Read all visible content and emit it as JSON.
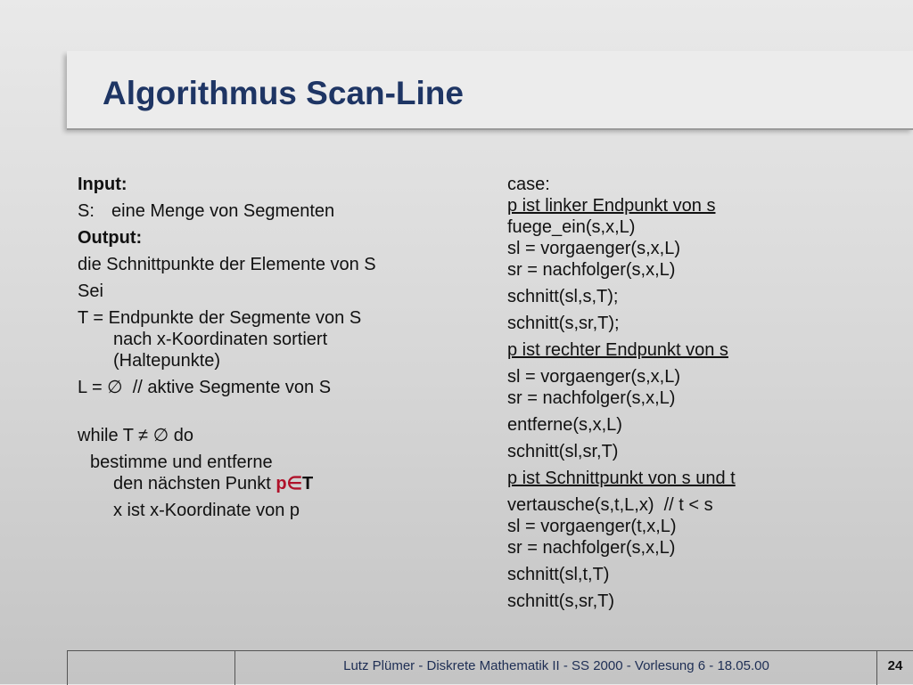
{
  "title": "Algorithmus Scan-Line",
  "left": {
    "input_label": "Input:",
    "s_label": "S:",
    "s_text": "eine Menge von Segmenten",
    "output_label": "Output:",
    "output_text": "die Schnittpunkte der Elemente von S",
    "sei": "Sei",
    "t_line1": "T = Endpunkte der Segmente von S",
    "t_line2": "nach x-Koordinaten sortiert",
    "t_line3": "(Haltepunkte)",
    "l_line": "L = ∅  // aktive Segmente von S",
    "while_line": "while T ≠ ∅ do",
    "bestimme_line1": "bestimme und entferne",
    "bestimme_line2_prefix": "den nächsten Punkt ",
    "bestimme_line2_p": "p∈",
    "bestimme_line2_t": "T",
    "x_line": "x ist x-Koordinate von p"
  },
  "right": {
    "case": "case:",
    "c1_head": "p ist linker Endpunkt von s",
    "c1_l1": "fuege_ein(s,x,L)",
    "c1_l2": "sl = vorgaenger(s,x,L)",
    "c1_l3": "sr = nachfolger(s,x,L)",
    "c1_l4": "schnitt(sl,s,T);",
    "c1_l5": "schnitt(s,sr,T);",
    "c2_head": "p ist rechter Endpunkt von s",
    "c2_l1": "sl = vorgaenger(s,x,L)",
    "c2_l2": "sr = nachfolger(s,x,L)",
    "c2_l3": "entferne(s,x,L)",
    "c2_l4": "schnitt(sl,sr,T)",
    "c3_head": "p ist Schnittpunkt von s und t",
    "c3_l1": "vertausche(s,t,L,x)  // t < s",
    "c3_l2": "sl = vorgaenger(t,x,L)",
    "c3_l3": "sr = nachfolger(s,x,L)",
    "c3_l4": "schnitt(sl,t,T)",
    "c3_l5": "schnitt(s,sr,T)"
  },
  "footer": {
    "text": "Lutz Plümer  -  Diskrete Mathematik II  -  SS 2000  -  Vorlesung 6  -  18.05.00",
    "page": "24"
  },
  "colors": {
    "title": "#1e3564",
    "highlight": "#b0122a",
    "footer_text": "#1e2e54"
  }
}
